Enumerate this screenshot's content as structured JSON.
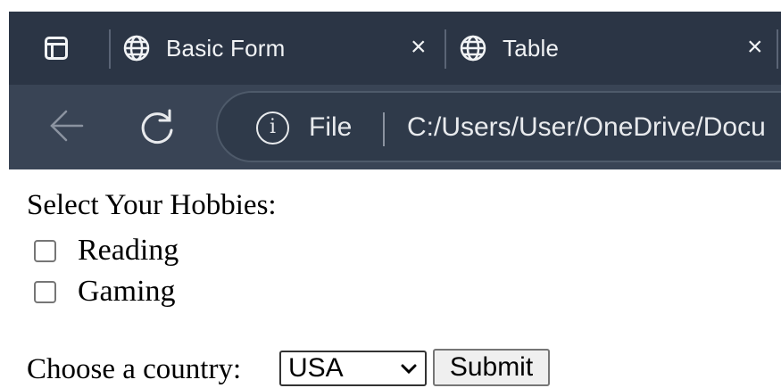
{
  "browser": {
    "tabs": [
      {
        "title": "Basic Form",
        "close_symbol": "×",
        "icon": "globe-icon"
      },
      {
        "title": "Table",
        "close_symbol": "×",
        "icon": "globe-icon"
      }
    ],
    "address": {
      "scheme_label": "File",
      "url": "C:/Users/User/OneDrive/Docu",
      "info_glyph": "i"
    },
    "colors": {
      "tabbar": "#2b3545",
      "toolbar": "#394455",
      "text": "#e8eaed"
    }
  },
  "form": {
    "hobbies_heading": "Select Your Hobbies:",
    "hobbies": [
      {
        "label": "Reading",
        "checked": false
      },
      {
        "label": "Gaming",
        "checked": false
      }
    ],
    "country_label": "Choose a country:",
    "country_selected": "USA",
    "submit_label": "Submit"
  }
}
